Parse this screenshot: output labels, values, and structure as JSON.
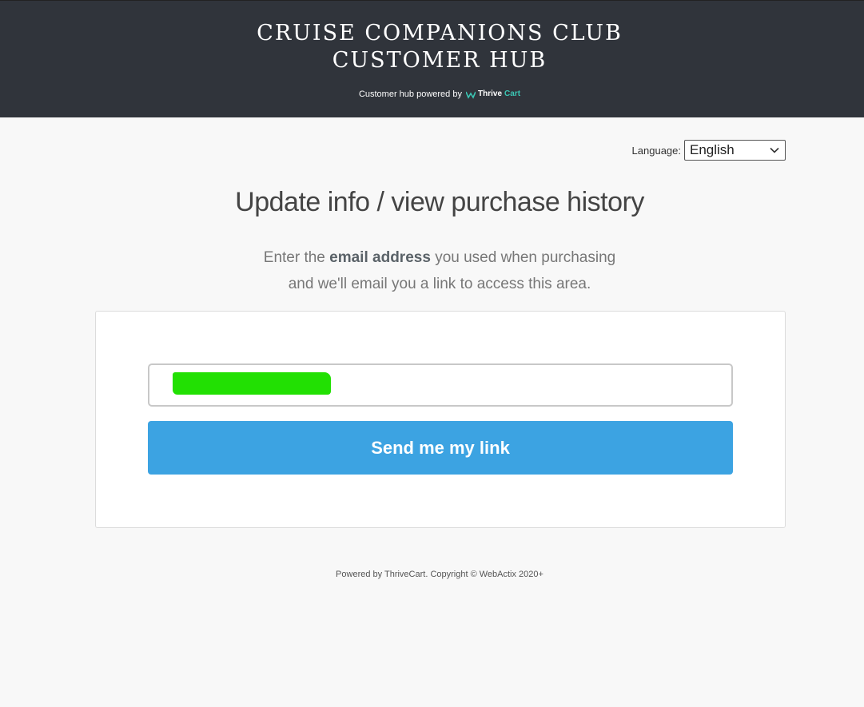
{
  "header": {
    "title_line1": "CRUISE COMPANIONS CLUB",
    "title_line2": "CUSTOMER HUB",
    "powered_text": "Customer hub powered by",
    "logo_thrive": "Thrive",
    "logo_cart": "Cart",
    "bg_color": "#30343b",
    "logo_accent_color": "#3bc6b4"
  },
  "language": {
    "label": "Language:",
    "selected": "English"
  },
  "main": {
    "title": "Update info / view purchase history",
    "subtitle_pre": "Enter the",
    "subtitle_bold": "email address",
    "subtitle_post": "you used when purchasing",
    "subtitle_line2": "and we'll email you a link to access this area."
  },
  "form": {
    "email_value": "",
    "redaction_color": "#22e003",
    "button_label": "Send me my link",
    "button_color": "#3ca3e2"
  },
  "footer": {
    "text": "Powered by ThriveCart. Copyright © WebActix 2020+"
  }
}
